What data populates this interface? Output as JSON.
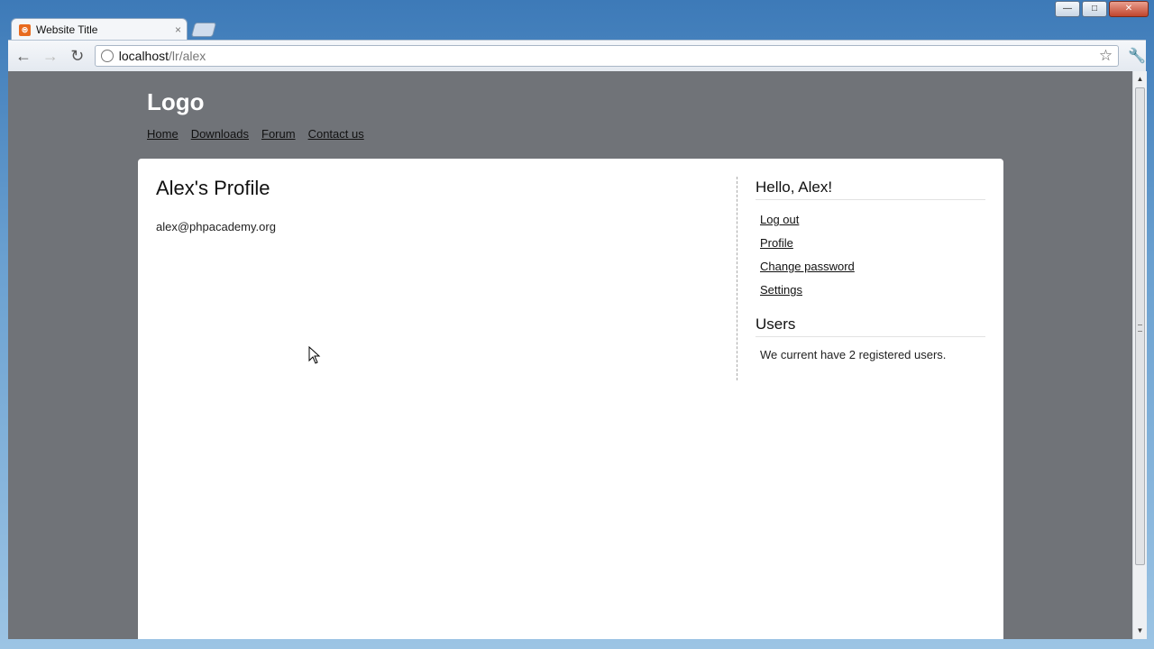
{
  "browser": {
    "tab_title": "Website Title",
    "url_host": "localhost",
    "url_path": "/lr/alex"
  },
  "site": {
    "logo": "Logo",
    "nav": [
      "Home",
      "Downloads",
      "Forum",
      "Contact us"
    ]
  },
  "profile": {
    "title": "Alex's Profile",
    "email": "alex@phpacademy.org"
  },
  "sidebar": {
    "greeting": "Hello, Alex!",
    "links": [
      "Log out",
      "Profile",
      "Change password",
      "Settings"
    ],
    "users_title": "Users",
    "users_text": "We current have 2 registered users."
  }
}
